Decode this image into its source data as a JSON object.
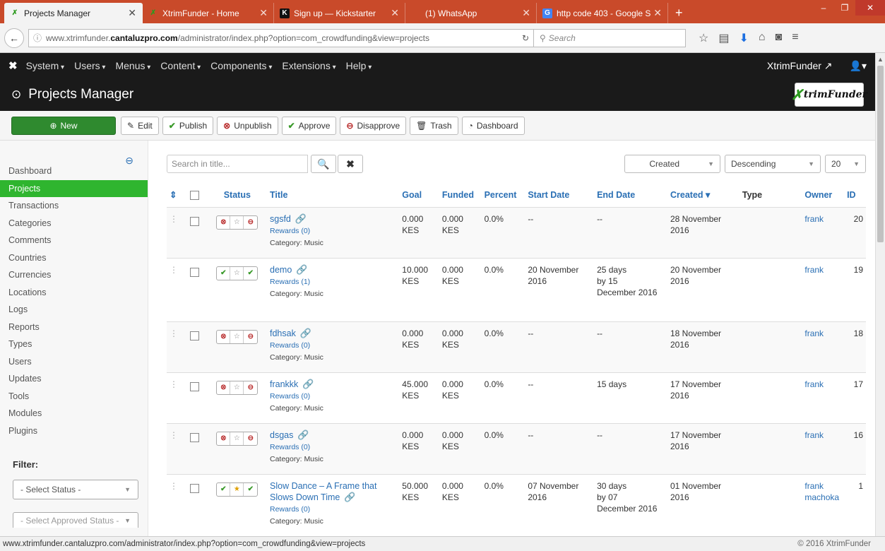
{
  "browser": {
    "tabs": [
      {
        "title": "Projects Manager",
        "active": true,
        "icon": "xtrim-icon"
      },
      {
        "title": "XtrimFunder - Home",
        "active": false,
        "icon": "xtrim-icon"
      },
      {
        "title": "Sign up — Kickstarter",
        "active": false,
        "icon": "kickstarter-icon"
      },
      {
        "title": "(1) WhatsApp",
        "active": false,
        "icon": "whatsapp-icon"
      },
      {
        "title": "http code 403 - Google Se...",
        "active": false,
        "icon": "google-icon"
      }
    ],
    "url_prefix": "www.xtrimfunder.",
    "url_domain": "cantaluzpro.com",
    "url_path": "/administrator/index.php?option=com_crowdfunding&view=projects",
    "search_placeholder": "Search",
    "status_url": "www.xtrimfunder.cantaluzpro.com/administrator/index.php?option=com_crowdfunding&view=projects"
  },
  "topnav": {
    "menus": [
      "System",
      "Users",
      "Menus",
      "Content",
      "Components",
      "Extensions",
      "Help"
    ],
    "site_link": "XtrimFunder"
  },
  "header": {
    "title": "Projects Manager",
    "brand": "trimFunder"
  },
  "toolbar": {
    "new": "New",
    "edit": "Edit",
    "publish": "Publish",
    "unpublish": "Unpublish",
    "approve": "Approve",
    "disapprove": "Disapprove",
    "trash": "Trash",
    "dashboard": "Dashboard"
  },
  "sidebar": {
    "items": [
      "Dashboard",
      "Projects",
      "Transactions",
      "Categories",
      "Comments",
      "Countries",
      "Currencies",
      "Locations",
      "Logs",
      "Reports",
      "Types",
      "Users",
      "Updates",
      "Tools",
      "Modules",
      "Plugins"
    ],
    "active": "Projects",
    "filter_label": "Filter:",
    "status_select": "- Select Status -",
    "approved_select": "- Select Approved Status -"
  },
  "list": {
    "search_placeholder": "Search in title...",
    "sort_field": "Created",
    "sort_dir": "Descending",
    "limit": "20",
    "columns": {
      "sort": "⇕",
      "status": "Status",
      "title": "Title",
      "goal": "Goal",
      "funded": "Funded",
      "percent": "Percent",
      "start": "Start Date",
      "end": "End Date",
      "created": "Created ▾",
      "type": "Type",
      "owner": "Owner",
      "id": "ID"
    },
    "rows": [
      {
        "title": "sgsfd",
        "rewards": "Rewards (0)",
        "category": "Category: Music",
        "goal": "0.000",
        "funded": "0.000",
        "currency": "KES",
        "percent": "0.0%",
        "start": "--",
        "end1": "--",
        "end2": "",
        "end3": "",
        "created1": "28 November",
        "created2": "2016",
        "owner": "frank",
        "id": "20",
        "published": false,
        "approved": false,
        "featured": false
      },
      {
        "title": "demo",
        "rewards": "Rewards (1)",
        "category": "Category: Music",
        "goal": "10.000",
        "funded": "0.000",
        "currency": "KES",
        "percent": "0.0%",
        "start": "20 November 2016",
        "end1": "25 days",
        "end2": "by 15",
        "end3": "December 2016",
        "created1": "20 November",
        "created2": "2016",
        "owner": "frank",
        "id": "19",
        "published": true,
        "approved": true,
        "featured": false
      },
      {
        "title": "fdhsak",
        "rewards": "Rewards (0)",
        "category": "Category: Music",
        "goal": "0.000",
        "funded": "0.000",
        "currency": "KES",
        "percent": "0.0%",
        "start": "--",
        "end1": "--",
        "end2": "",
        "end3": "",
        "created1": "18 November",
        "created2": "2016",
        "owner": "frank",
        "id": "18",
        "published": false,
        "approved": false,
        "featured": false
      },
      {
        "title": "frankkk",
        "rewards": "Rewards (0)",
        "category": "Category: Music",
        "goal": "45.000",
        "funded": "0.000",
        "currency": "KES",
        "percent": "0.0%",
        "start": "--",
        "end1": "15 days",
        "end2": "",
        "end3": "",
        "created1": "17 November",
        "created2": "2016",
        "owner": "frank",
        "id": "17",
        "published": false,
        "approved": false,
        "featured": false
      },
      {
        "title": "dsgas",
        "rewards": "Rewards (0)",
        "category": "Category: Music",
        "goal": "0.000",
        "funded": "0.000",
        "currency": "KES",
        "percent": "0.0%",
        "start": "--",
        "end1": "--",
        "end2": "",
        "end3": "",
        "created1": "17 November",
        "created2": "2016",
        "owner": "frank",
        "id": "16",
        "published": false,
        "approved": false,
        "featured": false
      },
      {
        "title": "Slow Dance – A Frame that Slows Down Time",
        "rewards": "Rewards (0)",
        "category": "Category: Music",
        "goal": "50.000",
        "funded": "0.000",
        "currency": "KES",
        "percent": "0.0%",
        "start": "07 November 2016",
        "end1": "30 days",
        "end2": "by 07",
        "end3": "December 2016",
        "created1": "01 November",
        "created2": "2016",
        "owner": "frank machoka",
        "id": "1",
        "published": true,
        "approved": true,
        "featured": true
      }
    ]
  },
  "footer": {
    "copyright": "© 2016 XtrimFunder"
  }
}
